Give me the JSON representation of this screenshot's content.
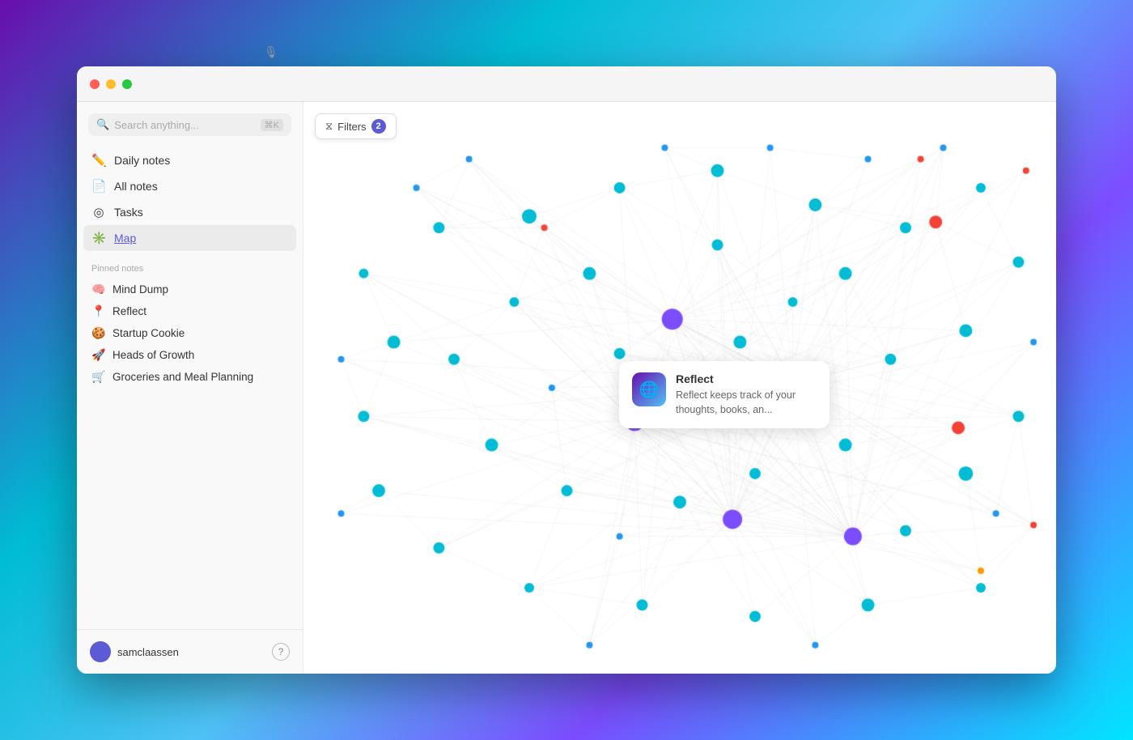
{
  "window": {
    "titlebar": {
      "traffic_lights": [
        "red",
        "yellow",
        "green"
      ]
    }
  },
  "sidebar": {
    "search": {
      "placeholder": "Search anything...",
      "shortcut": "⌘K"
    },
    "nav_items": [
      {
        "id": "daily-notes",
        "label": "Daily notes",
        "icon": "✏️",
        "active": false
      },
      {
        "id": "all-notes",
        "label": "All notes",
        "icon": "📄",
        "active": false
      },
      {
        "id": "tasks",
        "label": "Tasks",
        "icon": "◎",
        "active": false
      },
      {
        "id": "map",
        "label": "Map",
        "icon": "✳️",
        "active": true
      }
    ],
    "pinned_section_label": "Pinned notes",
    "pinned_items": [
      {
        "emoji": "🧠",
        "label": "Mind Dump"
      },
      {
        "emoji": "📍",
        "label": "Reflect"
      },
      {
        "emoji": "🍪",
        "label": "Startup Cookie"
      },
      {
        "emoji": "🚀",
        "label": "Heads of Growth"
      },
      {
        "emoji": "🛒",
        "label": "Groceries and Meal Planning"
      }
    ],
    "footer": {
      "username": "samclaassen",
      "help_label": "?"
    }
  },
  "map": {
    "filters_label": "Filters",
    "filters_count": "2"
  },
  "tooltip": {
    "title": "Reflect",
    "description": "Reflect keeps track of your thoughts, books, an...",
    "icon_emoji": "🌐"
  },
  "colors": {
    "accent": "#5b5bd6",
    "node_cyan": "#00bcd4",
    "node_purple": "#7c4dff",
    "node_red": "#f44336",
    "node_orange": "#ff9800",
    "node_blue": "#2196f3"
  }
}
